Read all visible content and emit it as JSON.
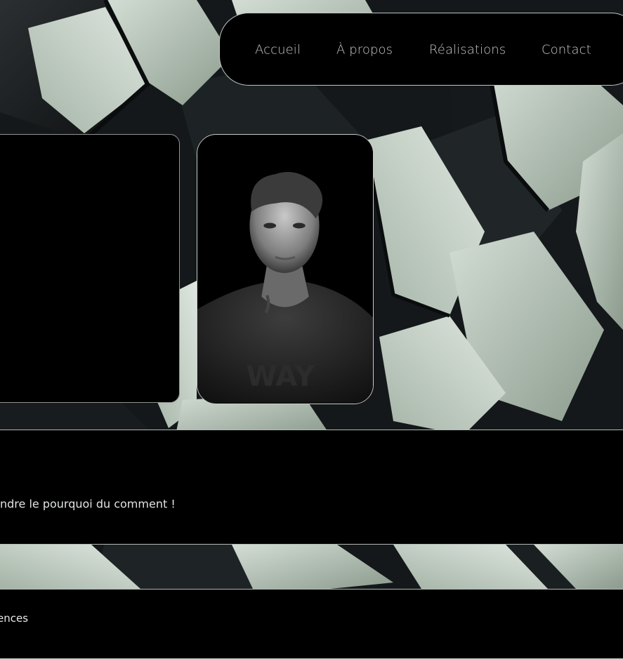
{
  "nav": {
    "items": [
      {
        "label": "Accueil"
      },
      {
        "label": "À propos"
      },
      {
        "label": "Réalisations"
      },
      {
        "label": "Contact"
      }
    ]
  },
  "hero": {
    "tagline": "ndre le pourquoi du comment !"
  },
  "section": {
    "title": "ences"
  },
  "colors": {
    "panel_bg": "#000000",
    "border": "#b3bab6",
    "nav_text": "#c5cbc8",
    "accent_sage": "#a9b9ab"
  }
}
